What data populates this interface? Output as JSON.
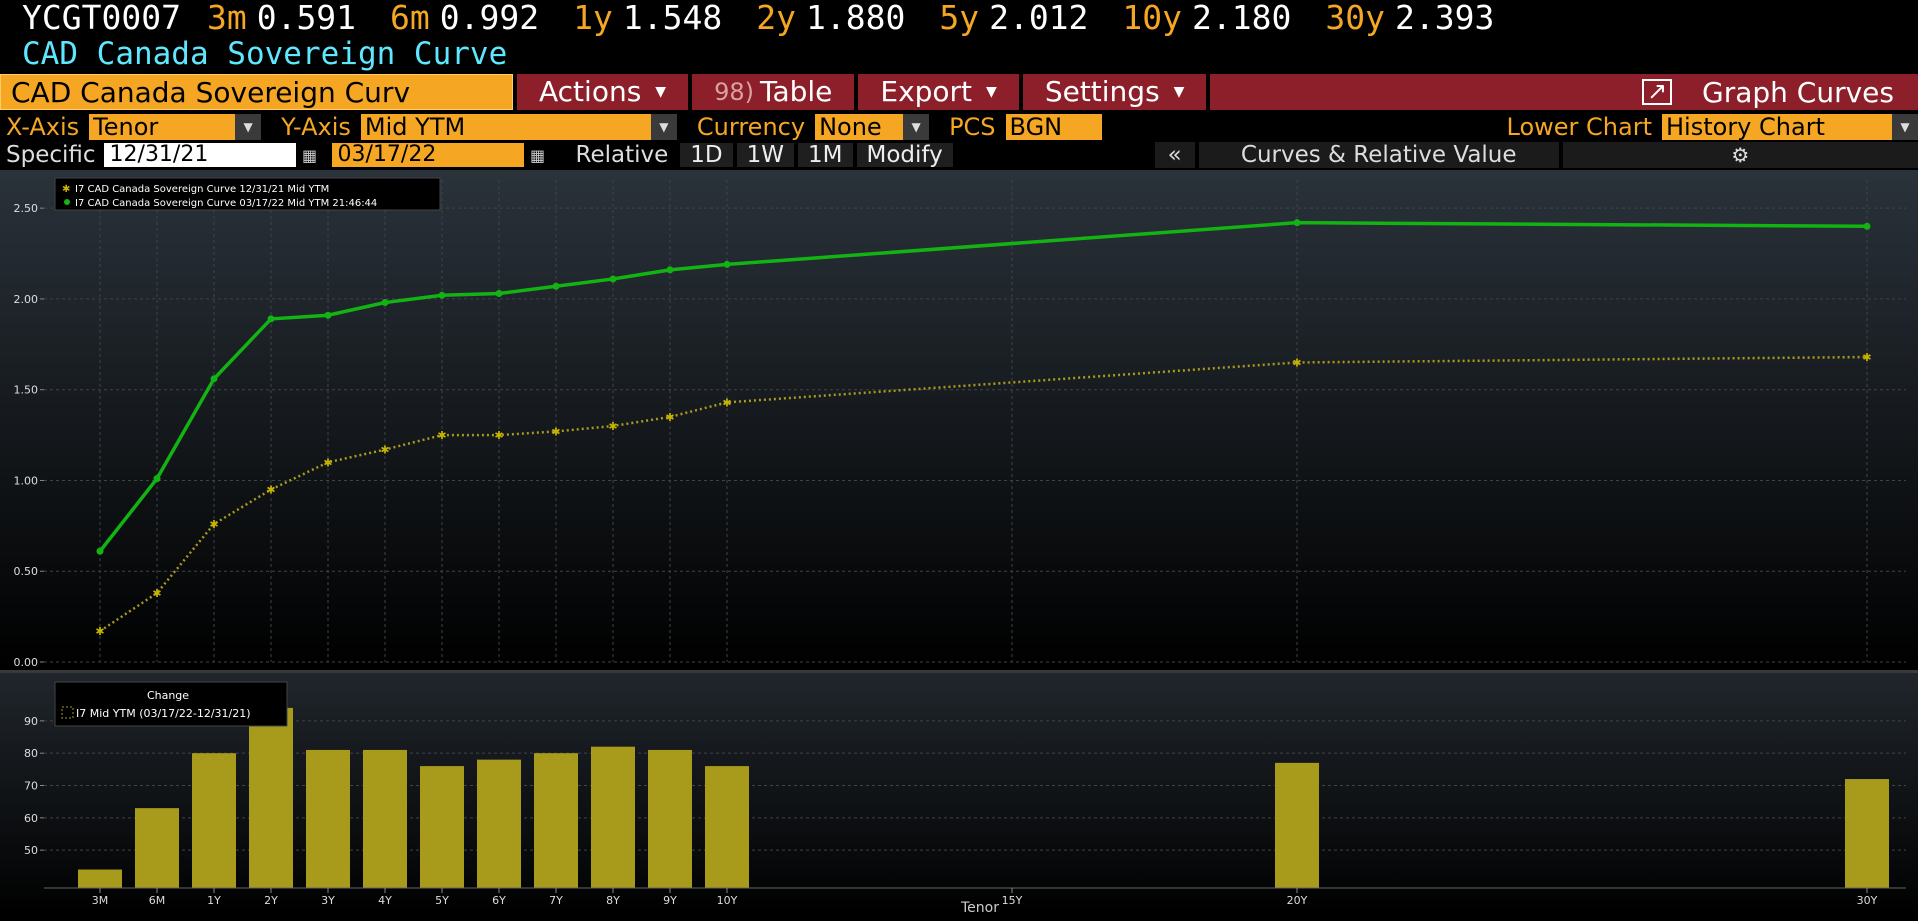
{
  "quote_line": {
    "ticker": "YCGT0007",
    "tenors": [
      {
        "name": "3m",
        "value": "0.591"
      },
      {
        "name": "6m",
        "value": "0.992"
      },
      {
        "name": "1y",
        "value": "1.548"
      },
      {
        "name": "2y",
        "value": "1.880"
      },
      {
        "name": "5y",
        "value": "2.012"
      },
      {
        "name": "10y",
        "value": "2.180"
      },
      {
        "name": "30y",
        "value": "2.393"
      }
    ]
  },
  "subtitle": "CAD Canada Sovereign Curve",
  "toolbar": {
    "title_field": "CAD Canada Sovereign Curv",
    "actions": "Actions",
    "table_num": "98)",
    "table": "Table",
    "export": "Export",
    "settings": "Settings",
    "graph_curves": "Graph Curves"
  },
  "axis_row": {
    "x_axis_label": "X-Axis",
    "x_axis_value": "Tenor",
    "y_axis_label": "Y-Axis",
    "y_axis_value": "Mid YTM",
    "currency_label": "Currency",
    "currency_value": "None",
    "pcs_label": "PCS",
    "pcs_value": "BGN",
    "lower_chart_label": "Lower Chart",
    "lower_chart_value": "History Chart"
  },
  "range_row": {
    "specific": "Specific",
    "date1": "12/31/21",
    "date2": "03/17/22",
    "relative": "Relative",
    "p1d": "1D",
    "p1w": "1W",
    "p1m": "1M",
    "modify": "Modify",
    "collapse": "«",
    "curves_rv": "Curves & Relative Value"
  },
  "colors": {
    "orange": "#f5a623",
    "cyan": "#5ee8ff",
    "button_red": "#8c1f2a",
    "green_curve": "#12b312",
    "gold_curve": "#a89b1c"
  },
  "chart_data": [
    {
      "type": "line",
      "x": [
        0.25,
        0.5,
        1,
        2,
        3,
        4,
        5,
        6,
        7,
        8,
        9,
        10,
        20,
        30
      ],
      "x_tick_labels": [
        "3M",
        "6M",
        "1Y",
        "2Y",
        "3Y",
        "4Y",
        "5Y",
        "6Y",
        "7Y",
        "8Y",
        "9Y",
        "10Y",
        "15Y",
        "20Y",
        "30Y"
      ],
      "xlabel": "Tenor",
      "ylim": [
        0,
        2.6
      ],
      "y_ticks": [
        "0.00",
        "0.50",
        "1.00",
        "1.50",
        "2.00",
        "2.50"
      ],
      "grid": true,
      "legend_position": "top-left",
      "series": [
        {
          "name": "I7 CAD Canada Sovereign Curve 12/31/21 Mid YTM",
          "style": "dotted",
          "values": [
            0.17,
            0.38,
            0.76,
            0.95,
            1.1,
            1.17,
            1.25,
            1.25,
            1.27,
            1.3,
            1.35,
            1.43,
            1.65,
            1.68
          ]
        },
        {
          "name": "I7 CAD Canada Sovereign Curve 03/17/22 Mid YTM 21:46:44",
          "style": "solid",
          "values": [
            0.61,
            1.01,
            1.56,
            1.89,
            1.91,
            1.98,
            2.02,
            2.03,
            2.07,
            2.11,
            2.16,
            2.19,
            2.42,
            2.4
          ]
        }
      ]
    },
    {
      "type": "bar",
      "title": "Change",
      "categories": [
        "3M",
        "6M",
        "1Y",
        "2Y",
        "3Y",
        "4Y",
        "5Y",
        "6Y",
        "7Y",
        "8Y",
        "9Y",
        "10Y",
        "20Y",
        "30Y"
      ],
      "series": [
        {
          "name": "I7 Mid YTM (03/17/22-12/31/21)",
          "values": [
            44,
            63,
            80,
            94,
            81,
            81,
            76,
            78,
            80,
            82,
            81,
            76,
            77,
            72
          ]
        }
      ],
      "ylim": [
        42,
        98
      ],
      "y_ticks": [
        "50",
        "60",
        "70",
        "80",
        "90"
      ],
      "xlabel": "Tenor"
    }
  ]
}
